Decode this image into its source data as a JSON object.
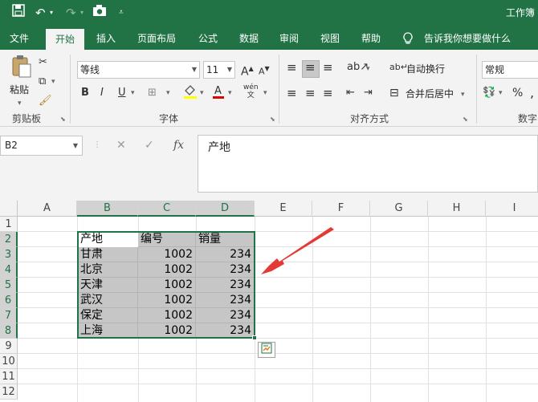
{
  "titlebar": {
    "save_icon": "save-icon",
    "undo_icon": "undo-icon",
    "redo_icon": "redo-icon",
    "camera_icon": "camera-icon",
    "customize_icon": "customize-icon",
    "title": "工作簿"
  },
  "tabs": [
    "文件",
    "开始",
    "插入",
    "页面布局",
    "公式",
    "数据",
    "审阅",
    "视图",
    "帮助"
  ],
  "active_tab": "开始",
  "tell_me": "告诉我你想要做什么",
  "ribbon": {
    "clipboard": {
      "paste_label": "粘贴",
      "group_label": "剪贴板"
    },
    "font": {
      "font_name": "等线",
      "font_size": "11",
      "group_label": "字体",
      "bold": "B",
      "italic": "I",
      "underline": "U",
      "phonetic": "wén"
    },
    "alignment": {
      "wrap_text": "自动换行",
      "merge_center": "合并后居中",
      "group_label": "对齐方式"
    },
    "number": {
      "format": "常规",
      "percent": "%",
      "group_label": "数字"
    }
  },
  "formula_bar": {
    "name_box": "B2",
    "fx": "fx",
    "content": "产地"
  },
  "grid": {
    "columns": [
      "A",
      "B",
      "C",
      "D",
      "E",
      "F",
      "G",
      "H",
      "I"
    ],
    "rows": [
      "1",
      "2",
      "3",
      "4",
      "5",
      "6",
      "7",
      "8",
      "9",
      "10",
      "11",
      "12"
    ],
    "selected_columns": [
      "B",
      "C",
      "D"
    ],
    "selected_rows": [
      "2",
      "3",
      "4",
      "5",
      "6",
      "7",
      "8"
    ],
    "headers": [
      "产地",
      "编号",
      "销量"
    ],
    "data": [
      [
        "甘肃",
        "1002",
        "234"
      ],
      [
        "北京",
        "1002",
        "234"
      ],
      [
        "天津",
        "1002",
        "234"
      ],
      [
        "武汉",
        "1002",
        "234"
      ],
      [
        "保定",
        "1002",
        "234"
      ],
      [
        "上海",
        "1002",
        "234"
      ]
    ]
  },
  "colors": {
    "accent": "#217346",
    "annotation_arrow": "#e53935",
    "selection_fill": "#c6c6c6"
  }
}
